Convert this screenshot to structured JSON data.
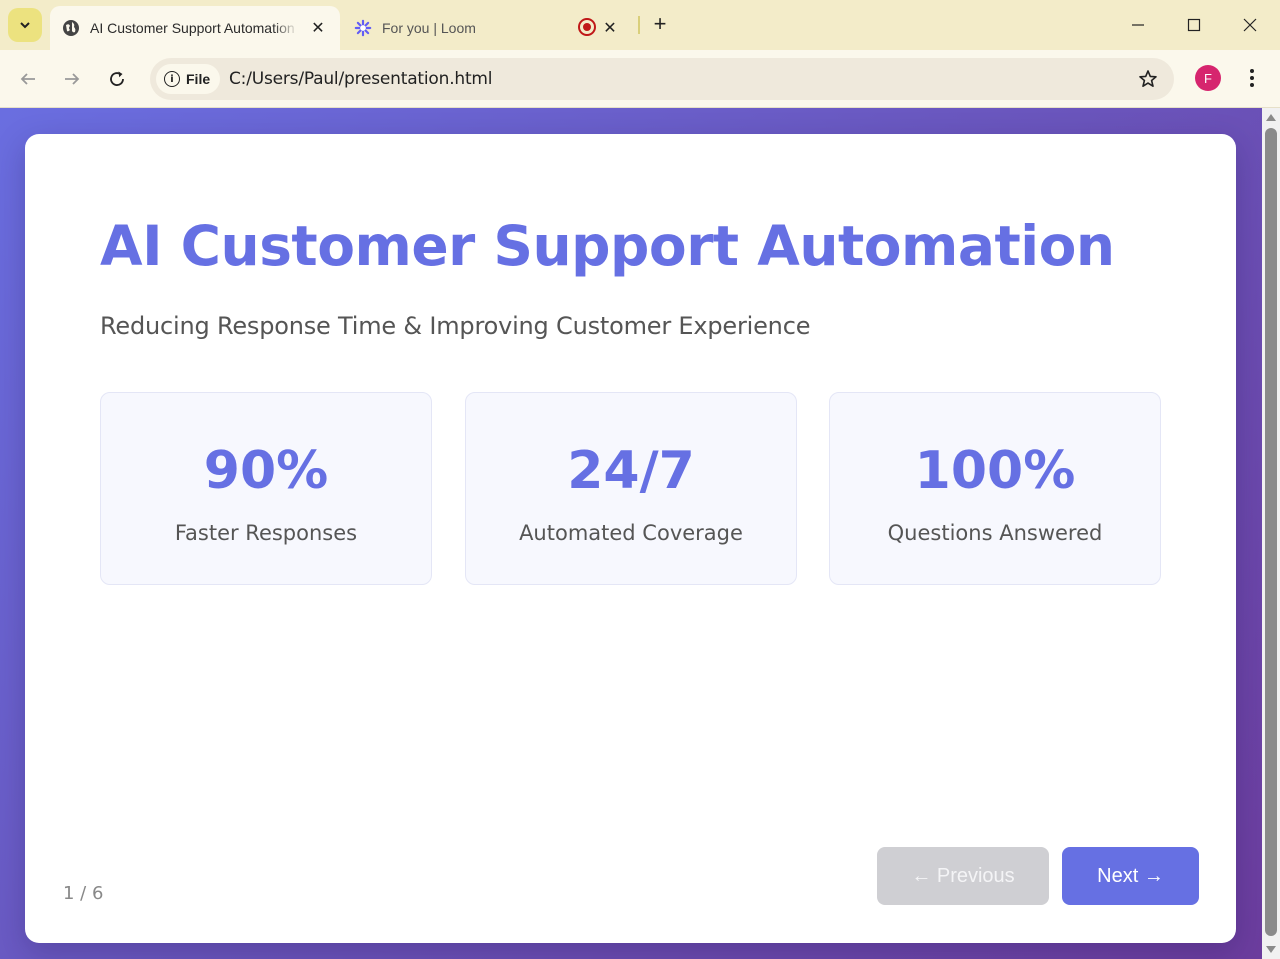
{
  "browser": {
    "tabs": [
      {
        "title": "AI Customer Support Automation",
        "icon": "globe-icon",
        "active": true
      },
      {
        "title": "For you | Loom",
        "icon": "loom-icon",
        "active": false,
        "recording": true
      }
    ],
    "address": {
      "chip_label": "File",
      "url": "C:/Users/Paul/presentation.html"
    },
    "profile_initial": "F"
  },
  "slide": {
    "title": "AI Customer Support Automation",
    "subtitle": "Reducing Response Time & Improving Customer Experience",
    "stats": [
      {
        "value": "90%",
        "label": "Faster Responses"
      },
      {
        "value": "24/7",
        "label": "Automated Coverage"
      },
      {
        "value": "100%",
        "label": "Questions Answered"
      }
    ],
    "counter": "1 / 6",
    "prev_label": "← Previous",
    "next_label": "Next →"
  },
  "colors": {
    "accent": "#6670e3",
    "background_gradient_start": "#6a6ee0",
    "background_gradient_end": "#6c3d9e",
    "tabstrip": "#f3ecc9"
  }
}
